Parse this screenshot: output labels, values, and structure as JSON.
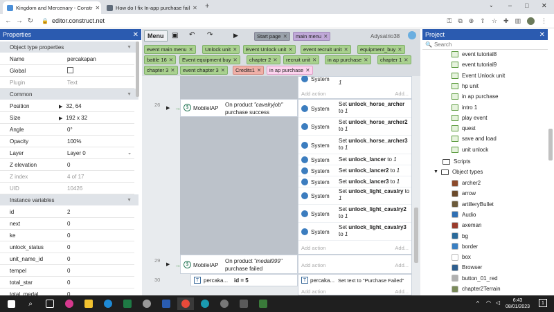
{
  "browser": {
    "tabs": [
      {
        "title": "Kingdom and Mercenary - Constr",
        "active": true
      },
      {
        "title": "How do I fix In-app purchase fail",
        "active": false
      }
    ],
    "new_tab": "+",
    "url": "editor.construct.net",
    "window_controls": [
      "–",
      "□",
      "✕"
    ]
  },
  "properties": {
    "header": "Properties",
    "close": "✕",
    "object_type_section": "Object type properties",
    "object_type": [
      {
        "key": "Name",
        "value": "percakapan"
      },
      {
        "key": "Global",
        "value": ""
      },
      {
        "key": "Plugin",
        "value": "Text"
      }
    ],
    "common_section": "Common",
    "common": [
      {
        "key": "Position",
        "value": "32, 64"
      },
      {
        "key": "Size",
        "value": "192 x 32"
      },
      {
        "key": "Angle",
        "value": "0°"
      },
      {
        "key": "Opacity",
        "value": "100%"
      },
      {
        "key": "Layer",
        "value": "Layer 0"
      },
      {
        "key": "Z elevation",
        "value": "0"
      },
      {
        "key": "Z index",
        "value": "4 of 17"
      },
      {
        "key": "UID",
        "value": "10426"
      }
    ],
    "instance_section": "Instance variables",
    "instance": [
      {
        "key": "id",
        "value": "2"
      },
      {
        "key": "next",
        "value": "0"
      },
      {
        "key": "ke",
        "value": "0"
      },
      {
        "key": "unlock_status",
        "value": "0"
      },
      {
        "key": "unit_name_id",
        "value": "0"
      },
      {
        "key": "tempel",
        "value": "0"
      },
      {
        "key": "total_star",
        "value": "0"
      },
      {
        "key": "total_medal",
        "value": "0"
      }
    ]
  },
  "editor": {
    "menu": "Menu",
    "user": "Adysatrio38",
    "top_tabs": [
      "Start page",
      "main menu"
    ],
    "tab_rows": [
      [
        "event main menu",
        "Unlock unit",
        "Event Unlock unit",
        "event recruit unit",
        "equipment_buy"
      ],
      [
        "battle 16",
        "Event equipment buy",
        "chapter 2",
        "recruit unit",
        "in ap purchase",
        "chapter 1"
      ],
      [
        "chapter 3",
        "event chapter 3",
        "Credits1",
        "in ap purchase"
      ]
    ],
    "tab_close": "✕",
    "add_action": "Add action",
    "add_action_faded": "Add...",
    "events": {
      "e26": {
        "num": "26",
        "object": "MobileIAP",
        "condition_prefix": "On product ",
        "product": "\"cavalryjob\"",
        "condition_suffix": "purchase success"
      },
      "e29": {
        "num": "29",
        "object": "MobileIAP",
        "condition_prefix": "On product ",
        "product": "\"medal999\"",
        "condition_suffix": "purchase failed"
      },
      "e30": {
        "num": "30",
        "object": "percaka...",
        "condition": "id = 5",
        "action_object": "percaka...",
        "action_text": "Set text to \"Purchase Failed\""
      }
    },
    "top_action": {
      "object": "System",
      "value": "1"
    },
    "actions": [
      {
        "object": "System",
        "var": "unlock_horse_archer",
        "value": "1"
      },
      {
        "object": "System",
        "var": "unlock_horse_archer2",
        "value": "1"
      },
      {
        "object": "System",
        "var": "unlock_horse_archer3",
        "value": "1"
      },
      {
        "object": "System",
        "var": "unlock_lancer",
        "value": "1"
      },
      {
        "object": "System",
        "var": "unlock_lancer2",
        "value": "1"
      },
      {
        "object": "System",
        "var": "unlock_lancer3",
        "value": "1"
      },
      {
        "object": "System",
        "var": "unlock_light_cavalry",
        "value": "1"
      },
      {
        "object": "System",
        "var": "unlock_light_cavalry2",
        "value": "1"
      },
      {
        "object": "System",
        "var": "unlock_light_cavalry3",
        "value": "1"
      }
    ],
    "set_word": "Set",
    "to_word": "to"
  },
  "project": {
    "header": "Project",
    "close": "✕",
    "search_placeholder": "Search",
    "event_sheets": [
      "event tutorial8",
      "event tutorial9",
      "Event Unlock unit",
      "hp unit",
      "in ap purchase",
      "intro 1",
      "play event",
      "quest",
      "save and load",
      "unit unlock"
    ],
    "scripts": "Scripts",
    "object_types_label": "Object types",
    "objects": [
      {
        "name": "archer2",
        "color": "#8b4a2b"
      },
      {
        "name": "arrow",
        "color": "#6b4a2b"
      },
      {
        "name": "artilleryBullet",
        "color": "#6b5a3b"
      },
      {
        "name": "Audio",
        "color": "#2f6fb3"
      },
      {
        "name": "axeman",
        "color": "#9a3b2b"
      },
      {
        "name": "bg",
        "color": "#2b6a9a"
      },
      {
        "name": "border",
        "color": "#3a7fc2"
      },
      {
        "name": "box",
        "color": "#ffffff"
      },
      {
        "name": "Browser",
        "color": "#2e5e8e"
      },
      {
        "name": "button_01_red",
        "color": "#b0b0b0"
      },
      {
        "name": "chapter2Terrain",
        "color": "#7a8a5a"
      }
    ]
  },
  "taskbar": {
    "time": "6:43",
    "date": "08/01/2023",
    "notif": "1"
  }
}
